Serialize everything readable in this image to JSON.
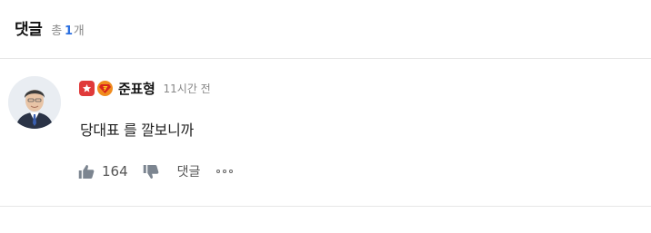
{
  "header": {
    "title": "댓글",
    "count_prefix": "총",
    "count": "1",
    "count_suffix": "개"
  },
  "comment": {
    "author": "준표형",
    "time": "11시간 전",
    "badges": [
      "star-badge-icon",
      "superman-badge-icon"
    ],
    "text": "당대표 를 깔보니까",
    "likes": "164",
    "reply_label": "댓글"
  },
  "colors": {
    "accent": "#2b6fe0",
    "divider": "#e6e6e6",
    "badge_star": "#e03a3a",
    "badge_super": "#f08c1f"
  }
}
